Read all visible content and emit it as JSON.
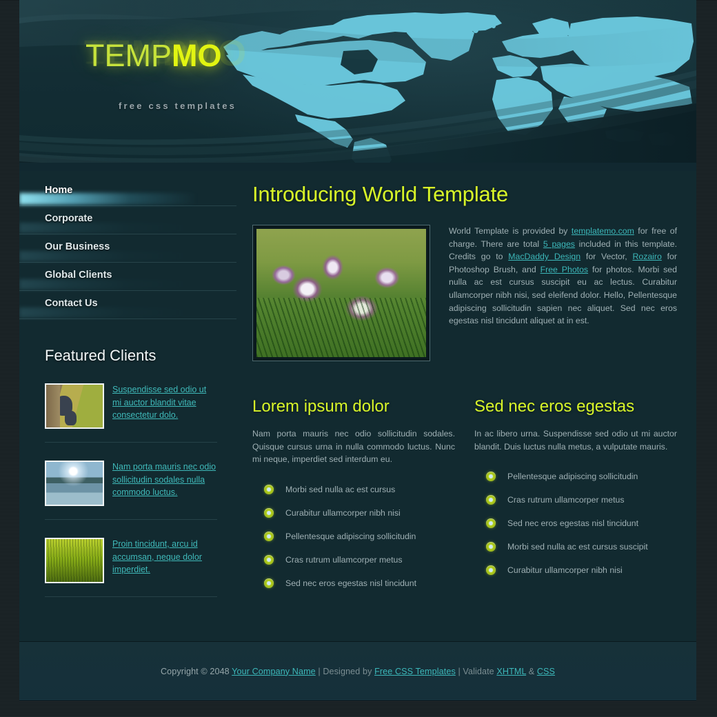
{
  "site": {
    "logo_text_light": "TEMP",
    "logo_text_bold": "MO",
    "tagline": "free css templates",
    "accent_yellow": "#d8f528",
    "accent_teal": "#3cb7b9",
    "map_cyan": "#6fd0e6",
    "background": "#122a30"
  },
  "nav": {
    "items": [
      {
        "label": "Home",
        "active": true
      },
      {
        "label": "Corporate",
        "active": false
      },
      {
        "label": "Our Business",
        "active": false
      },
      {
        "label": "Global Clients",
        "active": false
      },
      {
        "label": "Contact Us",
        "active": false
      }
    ]
  },
  "featured": {
    "heading": "Featured Clients",
    "clients": [
      {
        "thumb": "bird-photo-thumbnail",
        "link": "Suspendisse sed odio ut mi auctor blandit vitae consectetur dolo."
      },
      {
        "thumb": "lake-mountain-photo-thumbnail",
        "link": "Nam porta mauris nec odio sollicitudin sodales nulla commodo luctus."
      },
      {
        "thumb": "grass-field-photo-thumbnail",
        "link": "Proin tincidunt, arcu id accumsan, neque dolor imperdiet."
      }
    ]
  },
  "main": {
    "title": "Introducing World Template",
    "image_alt": "purple-and-white-daisy-flowers-photo",
    "intro": {
      "p1": "World Template is provided by ",
      "link1": "templatemo.com",
      "p2": " for free of charge. There are total ",
      "link2": "5 pages",
      "p3": " included in this template. Credits go to ",
      "link3": "MacDaddy Design",
      "p4": " for Vector, ",
      "link4": "Rozairo",
      "p5": " for Photoshop Brush, and ",
      "link5": "Free Photos",
      "p6": " for photos. Morbi sed nulla ac est cursus suscipit eu ac lectus. Curabitur ullamcorper nibh nisi, sed eleifend dolor. Hello, Pellentesque adipiscing sollicitudin sapien nec aliquet. Sed nec eros egestas nisl tincidunt aliquet at in est."
    },
    "columns": [
      {
        "heading": "Lorem ipsum dolor",
        "paragraph": "Nam porta mauris nec odio sollicitudin sodales. Quisque cursus urna in nulla commodo luctus. Nunc mi neque, imperdiet sed interdum eu.",
        "list": [
          "Morbi sed nulla ac est cursus",
          "Curabitur ullamcorper nibh nisi",
          "Pellentesque adipiscing sollicitudin",
          "Cras rutrum ullamcorper metus",
          "Sed nec eros egestas nisl tincidunt"
        ]
      },
      {
        "heading": "Sed nec eros egestas",
        "paragraph": "In ac libero urna. Suspendisse sed odio ut mi auctor blandit. Duis luctus nulla metus, a vulputate mauris.",
        "list": [
          "Pellentesque adipiscing sollicitudin",
          "Cras rutrum ullamcorper metus",
          "Sed nec eros egestas nisl tincidunt",
          "Morbi sed nulla ac est cursus suscipit",
          "Curabitur ullamcorper nibh nisi"
        ]
      }
    ]
  },
  "footer": {
    "copyright_prefix": "Copyright © 2048 ",
    "company_link": "Your Company Name",
    "designed_by_prefix": " | Designed by ",
    "designer_link": "Free CSS Templates",
    "validate_prefix": " | Validate ",
    "xhtml_link": "XHTML",
    "amp": " & ",
    "css_link": "CSS"
  }
}
